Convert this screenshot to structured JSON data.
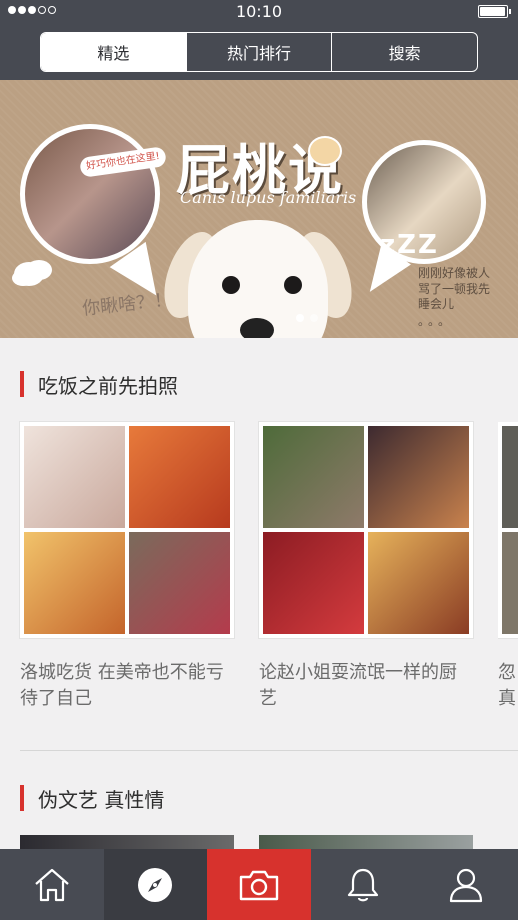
{
  "status_bar": {
    "time": "10:10",
    "signal_strength_dots": 3,
    "signal_total_dots": 5,
    "battery_level": 0.9
  },
  "tabs": [
    {
      "label": "精选",
      "active": true
    },
    {
      "label": "热门排行",
      "active": false
    },
    {
      "label": "搜索",
      "active": false
    }
  ],
  "banner": {
    "title": "屁桃说",
    "subtitle": "Canis lupus familiaris",
    "note_left": "好巧你也在这里!",
    "handwriting_left": "你瞅啥？！",
    "handwriting_right": "刚刚好像被人骂了一顿我先睡会儿",
    "handwriting_dots": "。。。",
    "zzz": "zZZ",
    "page_count": 2,
    "active_page": 1
  },
  "sections": [
    {
      "title": "吃饭之前先拍照",
      "cards": [
        {
          "caption": "洛城吃货 在美帝也不能亏待了自己",
          "tile_colors": [
            "#d8c3b8",
            "#c7532a",
            "#e1a34a",
            "#9b3b47"
          ]
        },
        {
          "caption": "论赵小姐耍流氓一样的厨艺",
          "tile_colors": [
            "#6a7a5a",
            "#50323c",
            "#b0242e",
            "#8a4b2e"
          ]
        },
        {
          "caption": "忽真",
          "tile_colors": [
            "#6c6b66",
            "#8aa1b6",
            "#7e7668",
            "#a5b7c5"
          ]
        }
      ]
    },
    {
      "title": "伪文艺 真性情"
    }
  ],
  "bottom_nav": [
    {
      "name": "home",
      "icon": "home-icon"
    },
    {
      "name": "discover",
      "icon": "compass-icon"
    },
    {
      "name": "camera",
      "icon": "camera-icon"
    },
    {
      "name": "notifications",
      "icon": "bell-icon"
    },
    {
      "name": "profile",
      "icon": "user-icon"
    }
  ],
  "colors": {
    "accent_red": "#d7322d",
    "header_bg": "#474a52",
    "nav_bg": "#484b53",
    "page_bg": "#f1f0f1"
  }
}
